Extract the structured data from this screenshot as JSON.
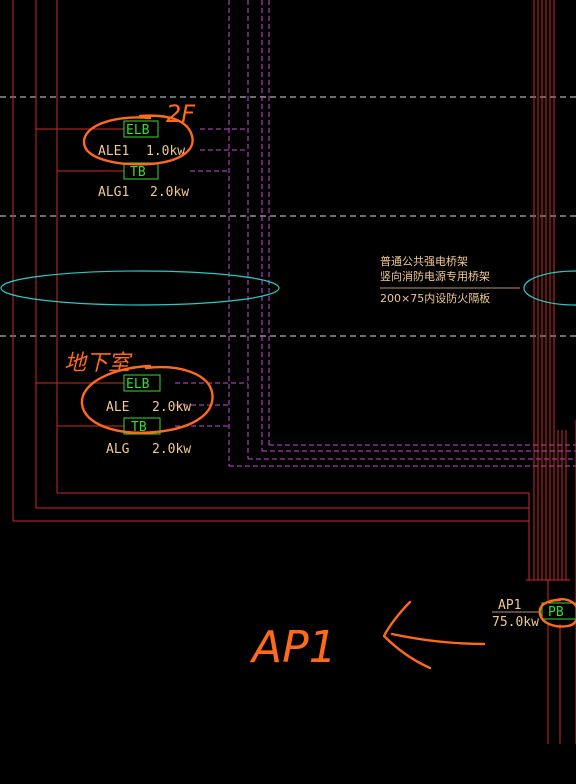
{
  "colors": {
    "background": "#000000",
    "wire_red": "#cc2a2a",
    "dashed_magenta": "#c84ad8",
    "dashed_white": "#d8d8d8",
    "label_tan": "#f0c890",
    "box_green": "#33dd33",
    "ellipse_cyan": "#2ac8c8",
    "annotation_orange": "#ff6a1a"
  },
  "panels": [
    {
      "box_label": "ELB",
      "name": "ALE1",
      "power": "1.0kw"
    },
    {
      "box_label": "TB",
      "name": "ALG1",
      "power": "2.0kw"
    },
    {
      "box_label": "ELB",
      "name": "ALE",
      "power": "2.0kw"
    },
    {
      "box_label": "TB",
      "name": "ALG",
      "power": "2.0kw"
    }
  ],
  "main_panel": {
    "box_label": "PB",
    "name": "AP1",
    "power": "75.0kw"
  },
  "tray_note": {
    "line1": "普通公共强电桥架",
    "line2": "竖向消防电源专用桥架",
    "line3": "200×75内设防火隔板"
  },
  "handwriting": {
    "floor_2f": "2F",
    "basement": "地下室",
    "ap1_note": "AP1"
  }
}
